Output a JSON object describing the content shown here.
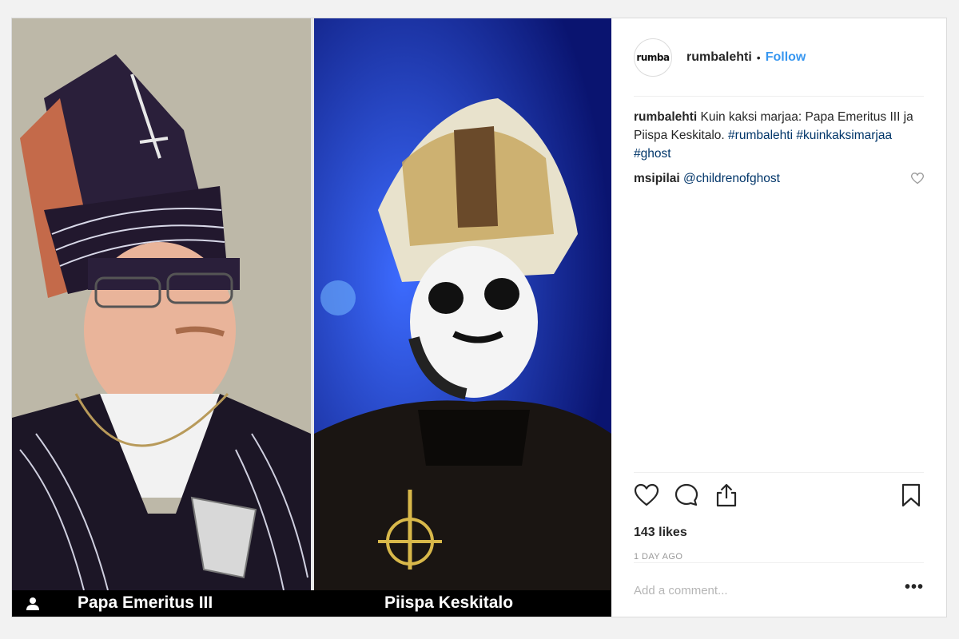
{
  "post": {
    "username": "rumbalehti",
    "avatar_text": "rumba",
    "separator": "•",
    "follow_label": "Follow",
    "caption": {
      "username": "rumbalehti",
      "text": "Kuin kaksi marjaa: Papa Emeritus III ja Piispa Keskitalo.",
      "hashtags": [
        "#rumbalehti",
        "#kuinkaksimarjaa",
        "#ghost"
      ]
    },
    "comments": [
      {
        "username": "msipilai",
        "text": "@childrenofghost"
      }
    ],
    "likes": "143 likes",
    "timestamp": "1 DAY AGO",
    "add_comment_placeholder": "Add a comment...",
    "more_label": "•••"
  },
  "media": {
    "left_caption": "Papa Emeritus III",
    "right_caption": "Piispa Keskitalo"
  },
  "icons": {
    "like": "heart-icon",
    "comment": "comment-bubble-icon",
    "share": "share-icon",
    "save": "bookmark-icon",
    "user_tag": "person-icon"
  },
  "colors": {
    "link": "#3897f0",
    "hashtag": "#003569",
    "border": "#dbdbdb",
    "muted": "#999999"
  }
}
